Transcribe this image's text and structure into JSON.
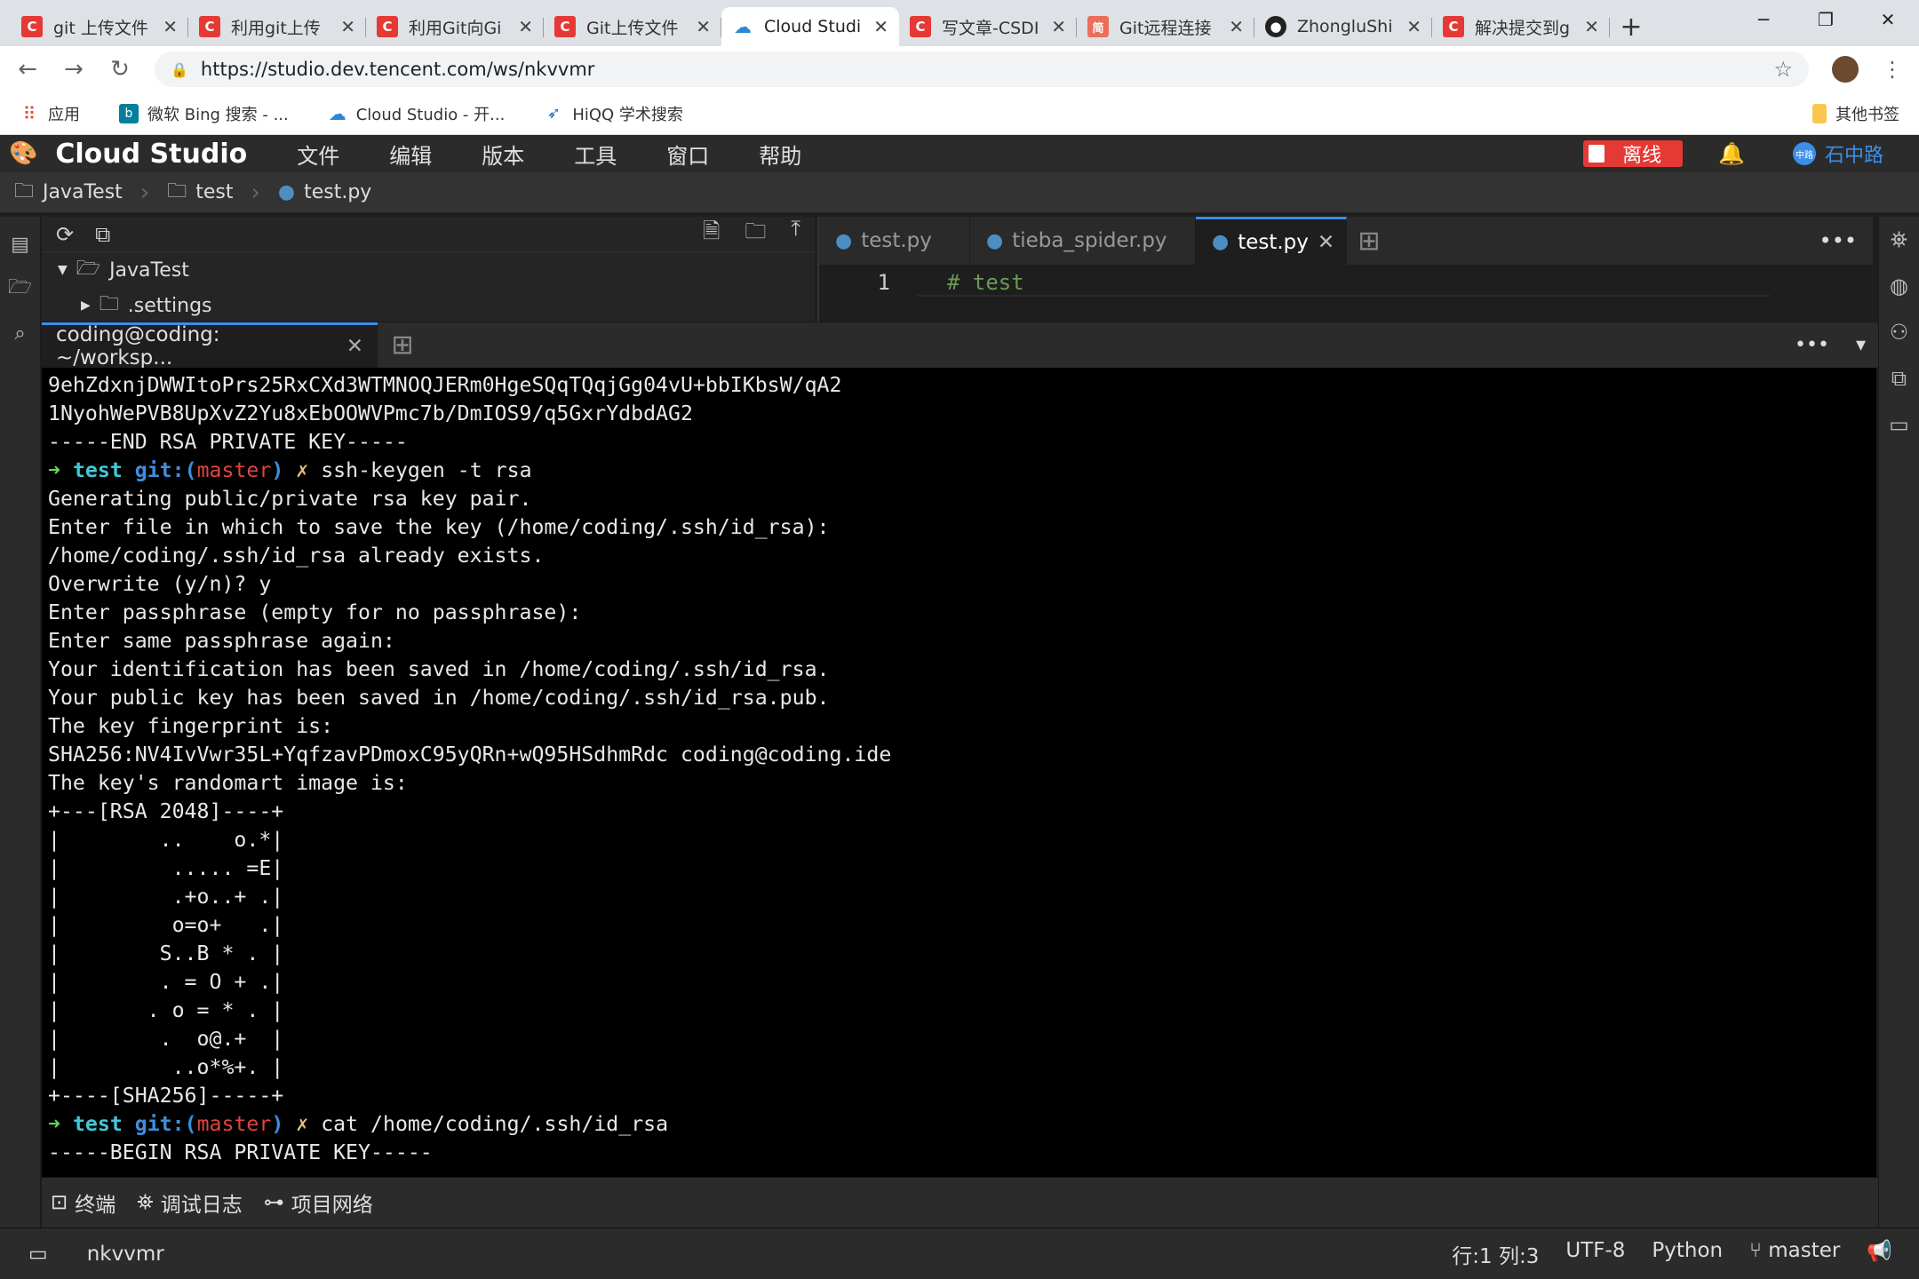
{
  "browser": {
    "tabs": [
      {
        "label": "git 上传文件",
        "icon": "csdn"
      },
      {
        "label": "利用git上传",
        "icon": "csdn"
      },
      {
        "label": "利用Git向Gi",
        "icon": "csdn"
      },
      {
        "label": "Git上传文件",
        "icon": "csdn"
      },
      {
        "label": "Cloud Studi",
        "icon": "cloud",
        "active": true
      },
      {
        "label": "写文章-CSDI",
        "icon": "csdn"
      },
      {
        "label": "Git远程连接",
        "icon": "jian"
      },
      {
        "label": "ZhongluShi",
        "icon": "github"
      },
      {
        "label": "解决提交到g",
        "icon": "csdn"
      }
    ],
    "url": "https://studio.dev.tencent.com/ws/nkvvmr",
    "bookmarks": [
      {
        "label": "应用",
        "icon": "apps-icon",
        "color": "#ea4335"
      },
      {
        "label": "微软 Bing 搜索 - ...",
        "icon": "bing-icon",
        "color": "#00809d"
      },
      {
        "label": "Cloud Studio - 开...",
        "icon": "cloud-icon",
        "color": "#2b88d8"
      },
      {
        "label": "HiQQ 学术搜索",
        "icon": "bird-icon",
        "color": "#1565c0"
      }
    ],
    "other_bookmarks": "其他书签"
  },
  "ide": {
    "title": "Cloud Studio",
    "menu": [
      "文件",
      "编辑",
      "版本",
      "工具",
      "窗口",
      "帮助"
    ],
    "status_toggle": "离线",
    "user_badge": "中路",
    "user_name": "石中路",
    "breadcrumb": [
      "JavaTest",
      "test",
      "test.py"
    ],
    "tree": [
      {
        "label": "JavaTest",
        "expanded": true
      },
      {
        "label": ".settings",
        "expanded": false
      }
    ],
    "editor_tabs": [
      "test.py",
      "tieba_spider.py",
      "test.py"
    ],
    "code_lines": [
      {
        "n": "1",
        "text": "# test"
      }
    ],
    "terminal_tab": "coding@coding: ~/worksp...",
    "terminal_prompt": {
      "arrow": "➜",
      "dir": "test",
      "git": "git:(",
      "branch": "master",
      "close": ")",
      "dirty": "✗"
    },
    "terminal": [
      {
        "text": "9ehZdxnjDWWItoPrs25RxCXd3WTMNOQJERm0HgeSQqTQqjGg04vU+bbIKbsW/qA2"
      },
      {
        "text": "1NyohWePVB8UpXvZ2Yu8xEbOOWVPmc7b/DmIOS9/q5GxrYdbdAG2"
      },
      {
        "text": "-----END RSA PRIVATE KEY-----"
      },
      {
        "prompt": true,
        "cmd": "ssh-keygen -t rsa"
      },
      {
        "text": "Generating public/private rsa key pair."
      },
      {
        "text": "Enter file in which to save the key (/home/coding/.ssh/id_rsa):"
      },
      {
        "text": "/home/coding/.ssh/id_rsa already exists."
      },
      {
        "text": "Overwrite (y/n)? y"
      },
      {
        "text": "Enter passphrase (empty for no passphrase):"
      },
      {
        "text": "Enter same passphrase again:"
      },
      {
        "text": "Your identification has been saved in /home/coding/.ssh/id_rsa."
      },
      {
        "text": "Your public key has been saved in /home/coding/.ssh/id_rsa.pub."
      },
      {
        "text": "The key fingerprint is:"
      },
      {
        "text": "SHA256:NV4IvVwr35L+YqfzavPDmoxC95yQRn+wQ95HSdhmRdc coding@coding.ide"
      },
      {
        "text": "The key's randomart image is:"
      },
      {
        "text": "+---[RSA 2048]----+"
      },
      {
        "text": "|        ..    o.*|"
      },
      {
        "text": "|         ..... =E|"
      },
      {
        "text": "|         .+o..+ .|"
      },
      {
        "text": "|         o=o+   .|"
      },
      {
        "text": "|        S..B * . |"
      },
      {
        "text": "|        . = O + .|"
      },
      {
        "text": "|       . o = * . |"
      },
      {
        "text": "|        .  o@.+  |"
      },
      {
        "text": "|         ..o*%+. |"
      },
      {
        "text": "+----[SHA256]-----+"
      },
      {
        "prompt": true,
        "cmd": "cat /home/coding/.ssh/id_rsa"
      },
      {
        "text": "-----BEGIN RSA PRIVATE KEY-----"
      }
    ],
    "bottom_tabs": [
      "终端",
      "调试日志",
      "项目网络"
    ],
    "status": {
      "workspace": "nkvvmr",
      "position": "行:1 列:3",
      "encoding": "UTF-8",
      "language": "Python",
      "branch": "master"
    }
  }
}
